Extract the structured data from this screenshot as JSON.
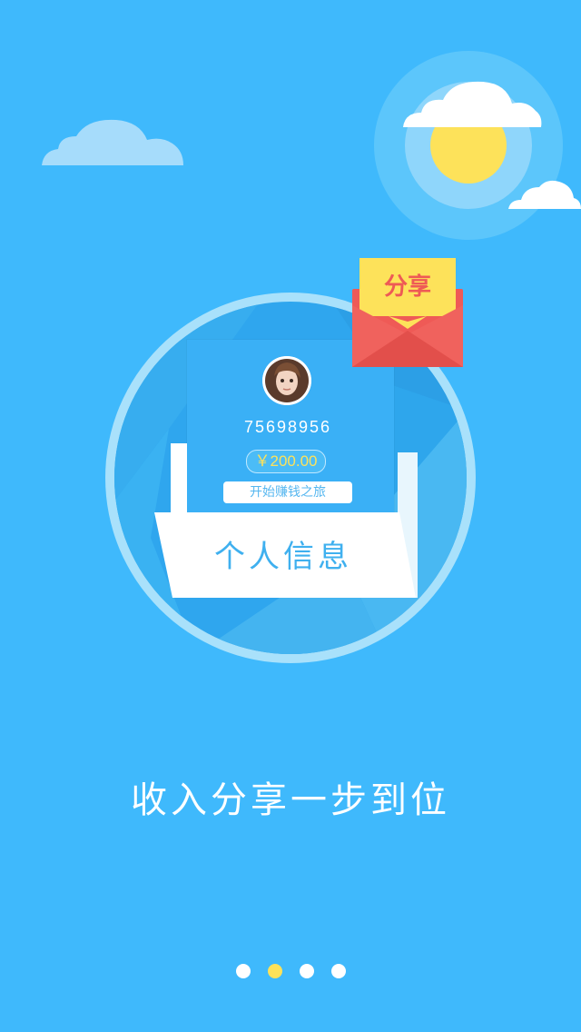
{
  "card": {
    "user_id": "75698956",
    "balance": "￥200.00",
    "start_label": "开始赚钱之旅",
    "banner_label": "个人信息"
  },
  "envelope": {
    "label": "分享"
  },
  "headline": "收入分享一步到位",
  "pagination": {
    "total": 4,
    "active_index": 1
  },
  "colors": {
    "background": "#3fb9fc",
    "sun": "#fde25a",
    "envelope": "#ef5a56",
    "active_dot": "#fde25a",
    "inactive_dot": "#ffffff"
  },
  "icons": [
    "cloud-icon",
    "sun-icon",
    "envelope-icon",
    "avatar"
  ]
}
